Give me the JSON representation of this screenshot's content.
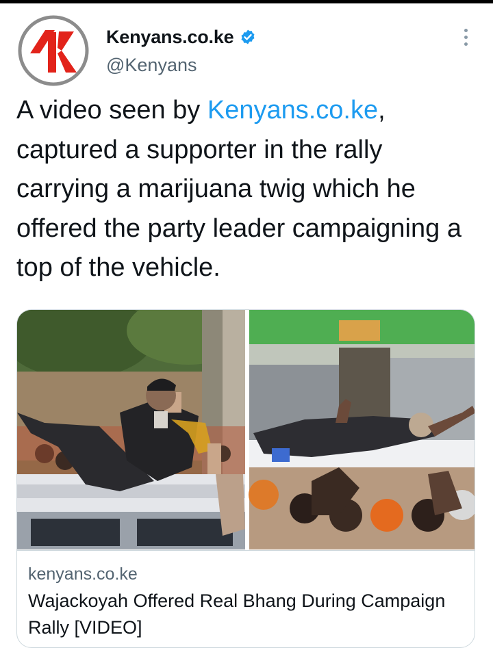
{
  "tweet": {
    "author": {
      "display_name": "Kenyans.co.ke",
      "handle": "@Kenyans",
      "verified": true,
      "avatar_icon": "kenyans-k-logo",
      "avatar_letter": "K"
    },
    "text_before": "A video seen by ",
    "text_link": "Kenyans.co.ke",
    "text_after": ", captured a supporter in the rally carrying a marijuana twig which he offered the party leader campaigning a top of the vehicle.",
    "more_icon": "more-vertical-icon"
  },
  "card": {
    "domain": "kenyans.co.ke",
    "title": "Wajackoyah Offered Real Bhang During Campaign Rally [VIDEO]"
  },
  "colors": {
    "link": "#1d9bf0",
    "verified": "#1d9bf0",
    "secondary_text": "#536471",
    "logo_red": "#e2231a",
    "logo_ring": "#8c8c8c"
  }
}
